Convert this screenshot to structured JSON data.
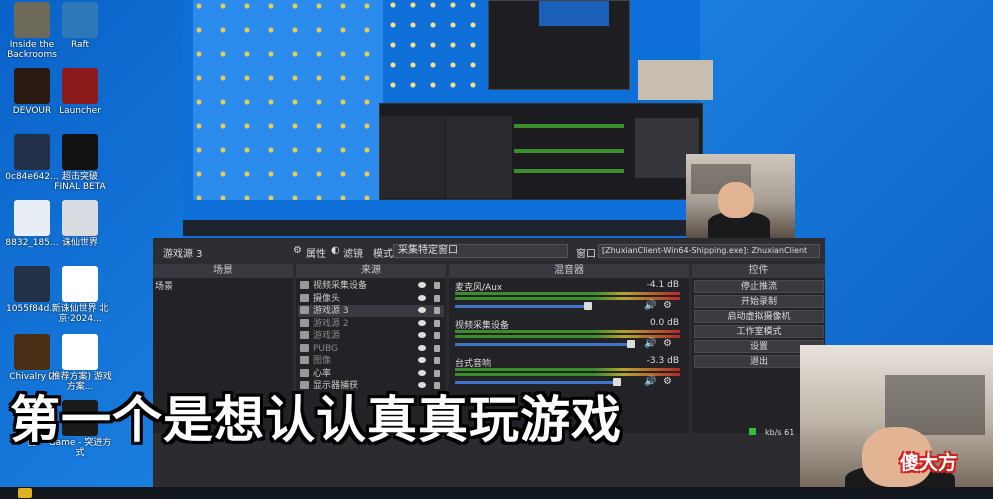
{
  "desktop_icons": [
    {
      "label": "Inside the Backrooms",
      "icon": "game-icon",
      "color": "#6d6a5a"
    },
    {
      "label": "Raft",
      "icon": "raft-icon",
      "color": "#2d78b8"
    },
    {
      "label": "DEVOUR",
      "icon": "devour-icon",
      "color": "#2a1a12"
    },
    {
      "label": "Launcher",
      "icon": "launcher-icon",
      "color": "#8b1b1b"
    },
    {
      "label": "0c84e642...",
      "icon": "file-icon",
      "color": "#22304a"
    },
    {
      "label": "超击突破 FINAL BETA",
      "icon": "game-icon",
      "color": "#111111"
    },
    {
      "label": "8832_185...",
      "icon": "image-icon",
      "color": "#e8eef5"
    },
    {
      "label": "诛仙世界",
      "icon": "zhuxian-icon",
      "color": "#d8dbe0"
    },
    {
      "label": "1055f84d...",
      "icon": "file-icon",
      "color": "#233248"
    },
    {
      "label": "新诛仙世界 北京·2024...",
      "icon": "document-icon",
      "color": "#ffffff"
    },
    {
      "label": "Chivalry 2",
      "icon": "chivalry-icon",
      "color": "#4a2f16"
    },
    {
      "label": "(推荐方案) 游戏方案...",
      "icon": "document-icon",
      "color": "#ffffff"
    },
    {
      "label": "器",
      "icon": "folder-icon",
      "color": "#888888"
    },
    {
      "label": "Game - 突进方式",
      "icon": "game-icon",
      "color": "#1b1b1b"
    }
  ],
  "obs": {
    "source_bar": {
      "current_source": "游戏源 3",
      "properties": "属性",
      "filters": "滤镜",
      "mode_label": "模式",
      "mode_value": "采集特定窗口",
      "window_label": "窗口",
      "window_value": "[ZhuxianClient-Win64-Shipping.exe]: ZhuxianClient"
    },
    "scenes": {
      "title": "场景",
      "items": [
        "场景"
      ]
    },
    "sources": {
      "title": "来源",
      "items": [
        "视频采集设备",
        "摄像头",
        "游戏源 3",
        "游戏源 2",
        "游戏源",
        "PUBG",
        "图像",
        "心率",
        "显示器捕获"
      ]
    },
    "mixer": {
      "title": "混音器",
      "channels": [
        {
          "name": "麦克风/Aux",
          "db": "-4.1 dB",
          "level": 0.74
        },
        {
          "name": "视频采集设备",
          "db": "0.0 dB",
          "level": 0.98
        },
        {
          "name": "台式音响",
          "db": "-3.3 dB",
          "level": 0.9
        }
      ]
    },
    "controls": {
      "title": "控件",
      "buttons": [
        "停止推流",
        "开始录制",
        "启动虚拟摄像机",
        "工作室模式",
        "设置",
        "退出"
      ]
    },
    "status": {
      "bitrate": "kb/s 61"
    }
  },
  "subtitle": "第一个是想认认真真玩游戏",
  "watermark": "傻大方"
}
